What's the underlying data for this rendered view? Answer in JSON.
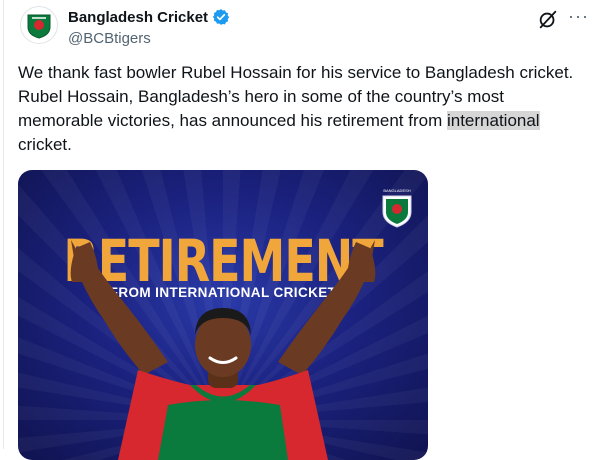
{
  "account": {
    "display_name": "Bangladesh Cricket",
    "handle": "@BCBtigers",
    "verified": true,
    "avatar_icon": "bcb-logo-icon"
  },
  "actions": {
    "grok_icon": "grok-icon",
    "more_label": "···"
  },
  "tweet": {
    "text_before": "We thank fast bowler Rubel Hossain for his service to Bangladesh cricket. Rubel Hossain, Bangladesh’s hero in some of the country’s most memorable victories, has announced his retirement from ",
    "text_highlight": "international",
    "text_after": " cricket."
  },
  "media": {
    "headline": "RETIREMENT",
    "subheadline": "FROM INTERNATIONAL CRICKET",
    "logo_label": "BANGLADESH",
    "colors": {
      "headline": "#f0a63a",
      "background": "#1b2280",
      "jersey_red": "#d7282f",
      "jersey_green": "#0a7a3d"
    }
  },
  "colors": {
    "verified": "#1d9bf0",
    "highlight": "#d6d6d6"
  }
}
